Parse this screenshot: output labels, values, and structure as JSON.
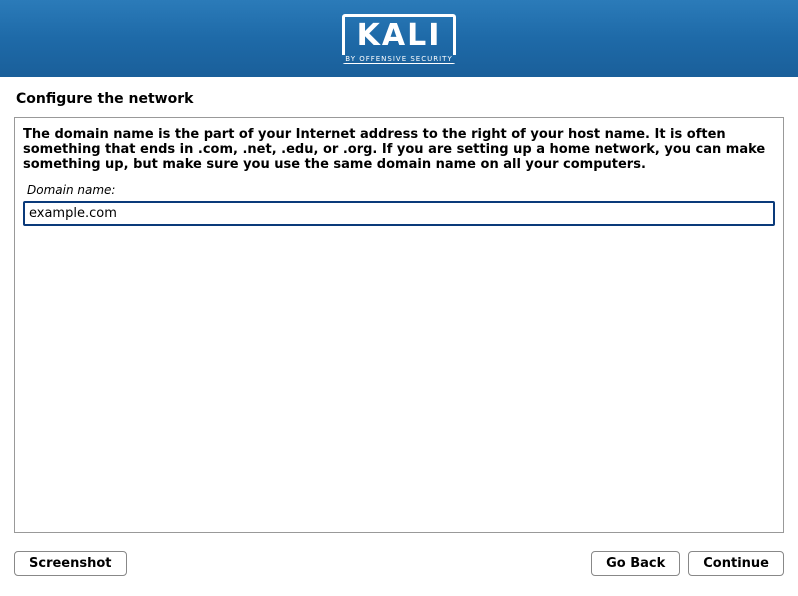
{
  "header": {
    "logo_text": "KALI",
    "logo_sub": "BY OFFENSIVE SECURITY"
  },
  "title": "Configure the network",
  "content": {
    "description": "The domain name is the part of your Internet address to the right of your host name.  It is often something that ends in .com, .net, .edu, or .org.  If you are setting up a home network, you can make something up, but make sure you use the same domain name on all your computers.",
    "field_label": "Domain name:",
    "field_value": "example.com"
  },
  "buttons": {
    "screenshot": "Screenshot",
    "go_back": "Go Back",
    "continue": "Continue"
  }
}
